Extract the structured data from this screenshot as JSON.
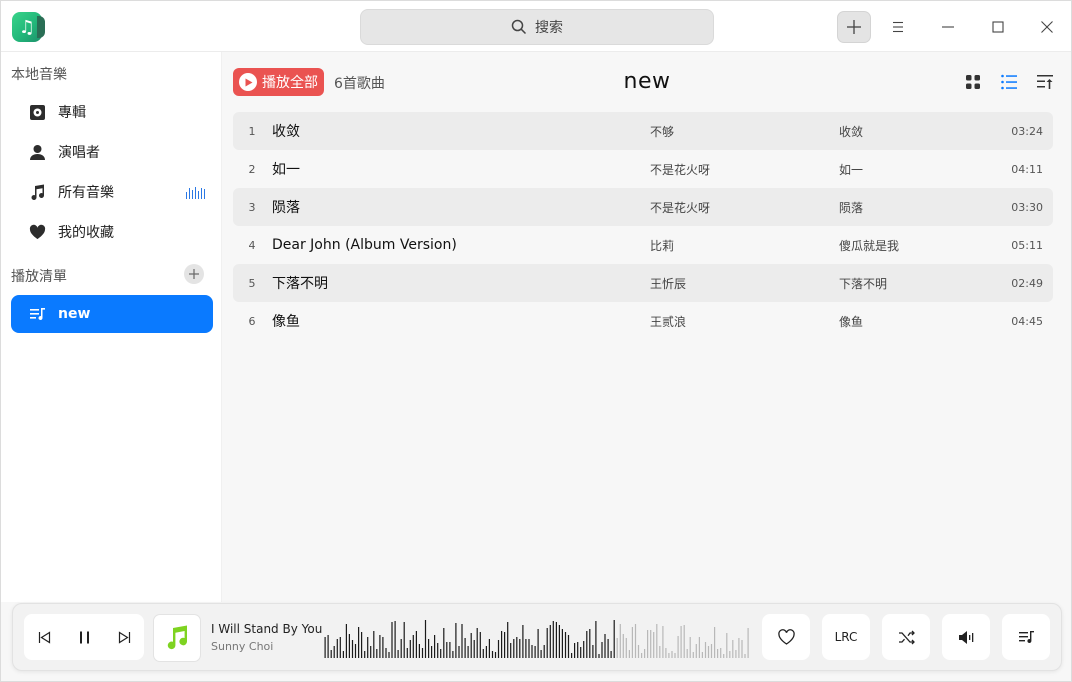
{
  "titlebar": {
    "app_icon": "music-note-icon",
    "search_placeholder": "搜索",
    "buttons": [
      "add-icon",
      "menu-icon",
      "minimize-icon",
      "maximize-icon",
      "close-icon"
    ]
  },
  "sidebar": {
    "local_title": "本地音樂",
    "items": [
      {
        "label": "專輯",
        "icon": "album-icon"
      },
      {
        "label": "演唱者",
        "icon": "person-icon"
      },
      {
        "label": "所有音樂",
        "icon": "music-note-icon"
      },
      {
        "label": "我的收藏",
        "icon": "heart-icon"
      }
    ],
    "playlist_title": "播放清單",
    "playlists": [
      {
        "label": "new",
        "icon": "playlist-icon",
        "active": true
      }
    ]
  },
  "main": {
    "play_all_label": "播放全部",
    "song_count": "6首歌曲",
    "title": "new",
    "tracks": [
      {
        "num": "1",
        "title": "收敛",
        "artist": "不够",
        "album": "收敛",
        "duration": "03:24"
      },
      {
        "num": "2",
        "title": "如一",
        "artist": "不是花火呀",
        "album": "如一",
        "duration": "04:11"
      },
      {
        "num": "3",
        "title": "陨落",
        "artist": "不是花火呀",
        "album": "陨落",
        "duration": "03:30"
      },
      {
        "num": "4",
        "title": "Dear John (Album Version)",
        "artist": "比莉",
        "album": "傻瓜就是我",
        "duration": "05:11"
      },
      {
        "num": "5",
        "title": "下落不明",
        "artist": "王忻辰",
        "album": "下落不明",
        "duration": "02:49"
      },
      {
        "num": "6",
        "title": "像鱼",
        "artist": "王贰浪",
        "album": "像鱼",
        "duration": "04:45"
      }
    ]
  },
  "player": {
    "now_title": "I Will Stand By You",
    "now_artist": "Sunny Choi",
    "progress": 0.68,
    "lrc_label": "LRC",
    "accent": "#0a7aff",
    "play_all_color": "#ea5351"
  }
}
